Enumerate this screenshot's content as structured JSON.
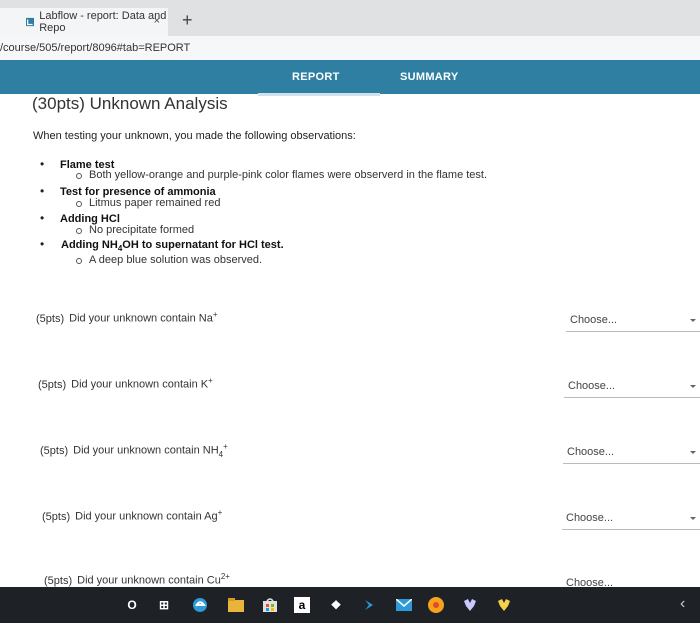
{
  "browser": {
    "tab_title": "Labflow - report: Data and Repo",
    "tab_close": "×",
    "new_tab": "+",
    "url": "/course/505/report/8096#tab=REPORT"
  },
  "nav": {
    "tabs": [
      {
        "label": "REPORT"
      },
      {
        "label": "SUMMARY"
      }
    ]
  },
  "section": {
    "title": "(30pts) Unknown Analysis",
    "intro": "When testing your unknown, you made the following observations:"
  },
  "observations": [
    {
      "label": "Flame test",
      "detail": "Both yellow-orange and purple-pink color flames were observerd in the flame test."
    },
    {
      "label": "Test for presence of ammonia",
      "detail": "Litmus paper remained red"
    },
    {
      "label": "Adding HCl",
      "detail": "No precipitate formed"
    },
    {
      "label_prefix": "Adding NH",
      "label_sub": "4",
      "label_suffix": "OH to supernatant for HCl test.",
      "detail": "A deep blue solution was observed."
    }
  ],
  "questions": [
    {
      "points": "(5pts)",
      "text": "Did your unknown contain Na",
      "sub": "",
      "sup": "+",
      "select": "Choose..."
    },
    {
      "points": "(5pts)",
      "text": "Did your unknown contain K",
      "sub": "",
      "sup": "+",
      "select": "Choose..."
    },
    {
      "points": "(5pts)",
      "text": "Did your unknown contain NH",
      "sub": "4",
      "sup": "+",
      "select": "Choose..."
    },
    {
      "points": "(5pts)",
      "text": "Did your unknown contain Ag",
      "sub": "",
      "sup": "+",
      "select": "Choose..."
    },
    {
      "points": "(5pts)",
      "text": "Did your unknown contain Cu",
      "sub": "",
      "sup": "2+",
      "select": "Choose..."
    }
  ],
  "taskbar": {
    "search_glyph": "O",
    "taskview_glyph": "⊞",
    "amazon_glyph": "a",
    "dropbox_glyph": "❖",
    "chevron": "‹",
    "colors": {
      "background": "#1e2126",
      "accent": "#2f7fa3"
    }
  }
}
